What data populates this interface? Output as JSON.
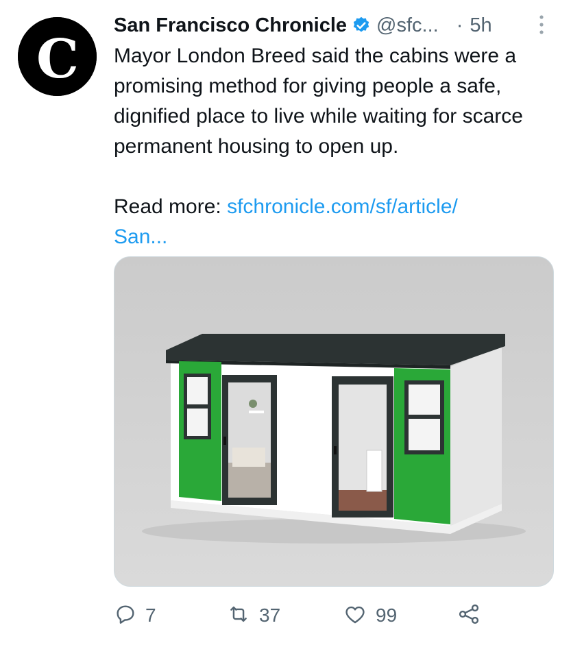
{
  "tweet": {
    "author_name": "San Francisco Chronicle",
    "handle": "@sfc...",
    "separator": "·",
    "time": "5h",
    "text": "Mayor London Breed said the cabins were a promising method for giving people a safe, dignified place to live while waiting for scarce permanent housing to open up.",
    "read_more_label": "Read more: ",
    "link_line1": "sfchronicle.com/sf/article/",
    "link_line2": "San...",
    "avatar_letter": "C"
  },
  "actions": {
    "replies": "7",
    "retweets": "37",
    "likes": "99"
  },
  "colors": {
    "link": "#1d9bf0",
    "secondary_text": "#536471",
    "verified": "#1d9bf0",
    "cabin_green": "#2aa838",
    "roof": "#2c3333"
  },
  "icons": [
    "verified-badge-icon",
    "more-options-icon",
    "reply-icon",
    "retweet-icon",
    "like-icon",
    "share-icon"
  ]
}
